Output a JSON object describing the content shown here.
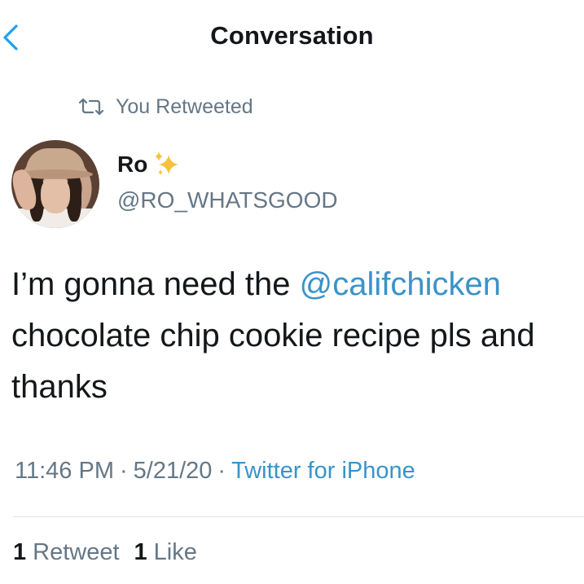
{
  "header": {
    "title": "Conversation",
    "back_icon": "chevron-left-icon"
  },
  "retweet_context": {
    "icon": "retweet-icon",
    "text": "You Retweeted"
  },
  "tweet": {
    "author": {
      "display_name": "Ro",
      "emoji_icon": "sparkles-icon",
      "handle": "@RO_WHATSGOOD"
    },
    "text_before": "I’m gonna need the ",
    "mention": "@califchicken",
    "text_after": " chocolate chip cookie recipe pls and thanks",
    "time": "11:46 PM",
    "date": "5/21/20",
    "separator": "·",
    "source": "Twitter for iPhone",
    "retweet_count": "1",
    "retweet_label": "Retweet",
    "like_count": "1",
    "like_label": "Like"
  },
  "colors": {
    "link": "#3a93c9",
    "secondary_text": "#657786",
    "primary_text": "#14171a",
    "accent": "#1da1f2"
  }
}
